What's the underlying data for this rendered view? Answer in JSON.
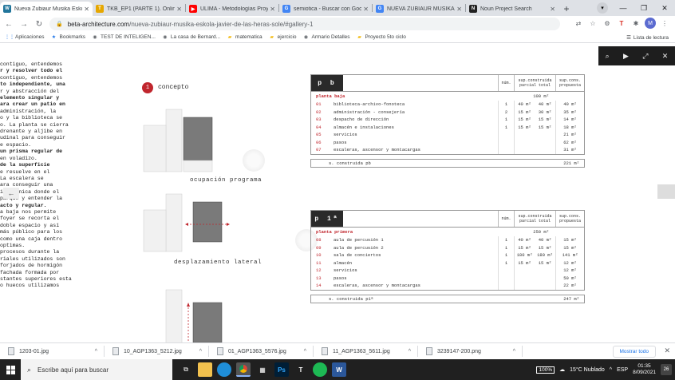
{
  "browser": {
    "tabs": [
      {
        "title": "Nueva Zubiaur Musika Esko",
        "icon": "wordpress-icon",
        "color": "#21759b",
        "glyph": "W",
        "active": true
      },
      {
        "title": "TKB_EP1 (PARTE 1). Online",
        "icon": "doc-icon",
        "color": "#e6a700",
        "glyph": "T"
      },
      {
        "title": "ULIMA - Metodologías Proy",
        "icon": "youtube-icon",
        "color": "#ff0000",
        "glyph": "▶"
      },
      {
        "title": "semiotica - Buscar con Goo",
        "icon": "google-icon",
        "color": "#4285f4",
        "glyph": "G"
      },
      {
        "title": "NUEVA ZUBIAUR MUSIKA E",
        "icon": "google-icon",
        "color": "#4285f4",
        "glyph": "G"
      },
      {
        "title": "Noun Project Search",
        "icon": "noun-icon",
        "color": "#222222",
        "glyph": "N"
      }
    ],
    "url_host": "beta-architecture.com",
    "url_path": "/nueva-zubiaur-musika-eskola-javier-de-las-heras-sole/#gallery-1",
    "bookmarks": [
      {
        "label": "Aplicaciones",
        "icon": "apps-icon"
      },
      {
        "label": "Bookmarks",
        "icon": "star-icon"
      },
      {
        "label": "TEST DE INTELIGEN...",
        "icon": "page-icon"
      },
      {
        "label": "La casa de Bernard...",
        "icon": "page-icon"
      },
      {
        "label": "matematica",
        "icon": "folder-icon"
      },
      {
        "label": "ejercicio",
        "icon": "folder-icon"
      },
      {
        "label": "Armario Detalles",
        "icon": "page-icon"
      },
      {
        "label": "Proyecto 5to ciclo",
        "icon": "folder-icon"
      }
    ],
    "reading_list": "Lista de lectura"
  },
  "article": {
    "left_lines": [
      "contiguo, entendemos",
      "r y resolver todo el",
      "",
      " contiguo, entendemos",
      "to independiente, una",
      "r   y   abstracción  del",
      " elemento  singular y",
      "",
      "ara crear  un patio en",
      " administración,  la",
      "o y la biblioteca se",
      "o. La planta se cierra",
      "drenante y aljibe en",
      "udinal para conseguir",
      "e espacio.",
      " un prisma regular de",
      "en voladizo.",
      "   de    la   superficie",
      "",
      "e resuelve en el",
      "  La escalera se",
      "ara conseguir una",
      "itectónica donde el",
      " parque y entender la",
      "acto y regular.",
      "a baja nos permite",
      " foyer se recorta el",
      " doble espacio y así",
      "más público para los",
      " como una caja dentro",
      "optimas.",
      "",
      " procesos durante la",
      "riales utilizados son",
      "",
      "forjados de hormigón",
      "",
      " fachada formada por",
      "",
      "",
      "stantes superiores esta",
      "o huecos utilizamos"
    ]
  },
  "concept": {
    "number": "1",
    "label": "concepto",
    "captions": [
      "ocupación programa",
      "desplazamiento lateral"
    ]
  },
  "table_pb": {
    "tag": "p b",
    "headers": {
      "num": "núm.",
      "supc": "sup.construida parcial total",
      "supp": "sup.cons. propuesta"
    },
    "section": "planta baja",
    "section_total": "100 m²",
    "rows": [
      {
        "code": "01",
        "name": "biblioteca-archivo-fonoteca",
        "num": "1",
        "a": "40 m²",
        "b": "40 m²",
        "p": "40 m²"
      },
      {
        "code": "02",
        "name": "administración - consejería",
        "num": "2",
        "a": "15 m²",
        "b": "30 m²",
        "p": "35 m²"
      },
      {
        "code": "03",
        "name": "despacho de dirección",
        "num": "1",
        "a": "15 m²",
        "b": "15 m²",
        "p": "14 m²"
      },
      {
        "code": "04",
        "name": "almacén e instalaciones",
        "num": "1",
        "a": "15 m²",
        "b": "15 m²",
        "p": "18 m²"
      },
      {
        "code": "05",
        "name": "servicios",
        "num": "",
        "a": "",
        "b": "",
        "p": "21 m²"
      },
      {
        "code": "06",
        "name": "pasos",
        "num": "",
        "a": "",
        "b": "",
        "p": "62 m²"
      },
      {
        "code": "07",
        "name": "escaleras, ascensor y montacargas",
        "num": "",
        "a": "",
        "b": "",
        "p": "31 m²"
      }
    ],
    "foot_label": "s. construida  pb",
    "foot_value": "221 m²"
  },
  "table_p1": {
    "tag": "p 1ª",
    "headers": {
      "num": "núm.",
      "supc": "sup.construida parcial total",
      "supp": "sup.cons. propuesta"
    },
    "section": "planta primera",
    "section_total": "250 m²",
    "rows": [
      {
        "code": "08",
        "name": "aula de percusión 1",
        "num": "1",
        "a": "40 m²",
        "b": "40 m²",
        "p": "15 m²"
      },
      {
        "code": "09",
        "name": "aula de percusión 2",
        "num": "1",
        "a": "15 m²",
        "b": "15 m²",
        "p": "15 m²"
      },
      {
        "code": "10",
        "name": "sala de conciertos",
        "num": "1",
        "a": "180 m²",
        "b": "180 m²",
        "p": "141 m²"
      },
      {
        "code": "11",
        "name": "almacén",
        "num": "1",
        "a": "15 m²",
        "b": "15 m²",
        "p": "12 m²"
      },
      {
        "code": "12",
        "name": "servicios",
        "num": "",
        "a": "",
        "b": "",
        "p": "12 m²"
      },
      {
        "code": "13",
        "name": "pasos",
        "num": "",
        "a": "",
        "b": "",
        "p": "50 m²"
      },
      {
        "code": "14",
        "name": "escaleras, ascensor y montacargas",
        "num": "",
        "a": "",
        "b": "",
        "p": "22 m²"
      }
    ],
    "foot_label": "s. construida  p1ª",
    "foot_value": "247 m²"
  },
  "downloads": {
    "items": [
      "1203-01.jpg",
      "10_AGP1363_5212.jpg",
      "01_AGP1363_5576.jpg",
      "11_AGP1363_5611.jpg",
      "3239147-200.png"
    ],
    "show_all": "Mostrar todo"
  },
  "taskbar": {
    "search_placeholder": "Escribe aquí para buscar",
    "battery": "100%",
    "weather": "15°C  Nublado",
    "lang": "ESP",
    "time": "01:35",
    "date": "8/09/2021",
    "notifications": "26"
  },
  "colors": {
    "accent_red": "#c0262d",
    "tab_bg": "#dee1e6",
    "taskbar": "#202020"
  }
}
